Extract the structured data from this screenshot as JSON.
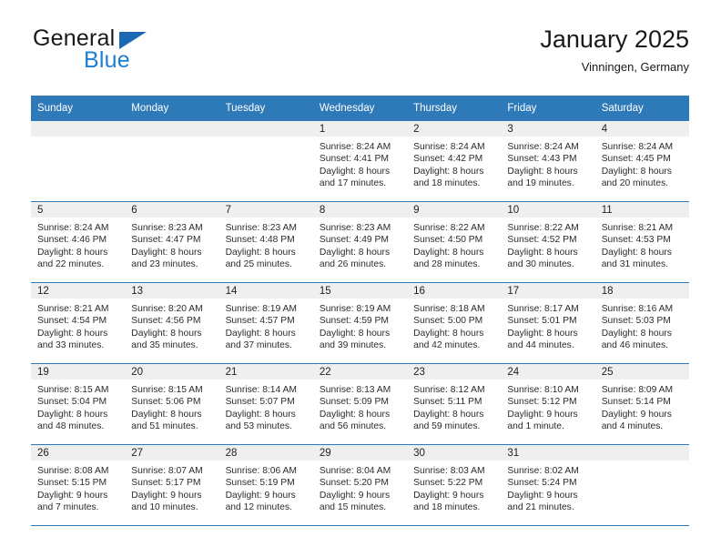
{
  "logo": {
    "word_one": "General",
    "word_two": "Blue",
    "triangle_color": "#1b68b3",
    "blue_color": "#1b7fd4"
  },
  "header": {
    "title": "January 2025",
    "location": "Vinningen, Germany"
  },
  "theme": {
    "header_bg": "#2e7ab8",
    "daynum_bg": "#efefef",
    "row_rule": "#2e7ab8"
  },
  "weekday_headers": [
    "Sunday",
    "Monday",
    "Tuesday",
    "Wednesday",
    "Thursday",
    "Friday",
    "Saturday"
  ],
  "weeks": [
    [
      {
        "day": "",
        "sunrise": "",
        "sunset": "",
        "daylight_line1": "",
        "daylight_line2": ""
      },
      {
        "day": "",
        "sunrise": "",
        "sunset": "",
        "daylight_line1": "",
        "daylight_line2": ""
      },
      {
        "day": "",
        "sunrise": "",
        "sunset": "",
        "daylight_line1": "",
        "daylight_line2": ""
      },
      {
        "day": "1",
        "sunrise": "Sunrise: 8:24 AM",
        "sunset": "Sunset: 4:41 PM",
        "daylight_line1": "Daylight: 8 hours",
        "daylight_line2": "and 17 minutes."
      },
      {
        "day": "2",
        "sunrise": "Sunrise: 8:24 AM",
        "sunset": "Sunset: 4:42 PM",
        "daylight_line1": "Daylight: 8 hours",
        "daylight_line2": "and 18 minutes."
      },
      {
        "day": "3",
        "sunrise": "Sunrise: 8:24 AM",
        "sunset": "Sunset: 4:43 PM",
        "daylight_line1": "Daylight: 8 hours",
        "daylight_line2": "and 19 minutes."
      },
      {
        "day": "4",
        "sunrise": "Sunrise: 8:24 AM",
        "sunset": "Sunset: 4:45 PM",
        "daylight_line1": "Daylight: 8 hours",
        "daylight_line2": "and 20 minutes."
      }
    ],
    [
      {
        "day": "5",
        "sunrise": "Sunrise: 8:24 AM",
        "sunset": "Sunset: 4:46 PM",
        "daylight_line1": "Daylight: 8 hours",
        "daylight_line2": "and 22 minutes."
      },
      {
        "day": "6",
        "sunrise": "Sunrise: 8:23 AM",
        "sunset": "Sunset: 4:47 PM",
        "daylight_line1": "Daylight: 8 hours",
        "daylight_line2": "and 23 minutes."
      },
      {
        "day": "7",
        "sunrise": "Sunrise: 8:23 AM",
        "sunset": "Sunset: 4:48 PM",
        "daylight_line1": "Daylight: 8 hours",
        "daylight_line2": "and 25 minutes."
      },
      {
        "day": "8",
        "sunrise": "Sunrise: 8:23 AM",
        "sunset": "Sunset: 4:49 PM",
        "daylight_line1": "Daylight: 8 hours",
        "daylight_line2": "and 26 minutes."
      },
      {
        "day": "9",
        "sunrise": "Sunrise: 8:22 AM",
        "sunset": "Sunset: 4:50 PM",
        "daylight_line1": "Daylight: 8 hours",
        "daylight_line2": "and 28 minutes."
      },
      {
        "day": "10",
        "sunrise": "Sunrise: 8:22 AM",
        "sunset": "Sunset: 4:52 PM",
        "daylight_line1": "Daylight: 8 hours",
        "daylight_line2": "and 30 minutes."
      },
      {
        "day": "11",
        "sunrise": "Sunrise: 8:21 AM",
        "sunset": "Sunset: 4:53 PM",
        "daylight_line1": "Daylight: 8 hours",
        "daylight_line2": "and 31 minutes."
      }
    ],
    [
      {
        "day": "12",
        "sunrise": "Sunrise: 8:21 AM",
        "sunset": "Sunset: 4:54 PM",
        "daylight_line1": "Daylight: 8 hours",
        "daylight_line2": "and 33 minutes."
      },
      {
        "day": "13",
        "sunrise": "Sunrise: 8:20 AM",
        "sunset": "Sunset: 4:56 PM",
        "daylight_line1": "Daylight: 8 hours",
        "daylight_line2": "and 35 minutes."
      },
      {
        "day": "14",
        "sunrise": "Sunrise: 8:19 AM",
        "sunset": "Sunset: 4:57 PM",
        "daylight_line1": "Daylight: 8 hours",
        "daylight_line2": "and 37 minutes."
      },
      {
        "day": "15",
        "sunrise": "Sunrise: 8:19 AM",
        "sunset": "Sunset: 4:59 PM",
        "daylight_line1": "Daylight: 8 hours",
        "daylight_line2": "and 39 minutes."
      },
      {
        "day": "16",
        "sunrise": "Sunrise: 8:18 AM",
        "sunset": "Sunset: 5:00 PM",
        "daylight_line1": "Daylight: 8 hours",
        "daylight_line2": "and 42 minutes."
      },
      {
        "day": "17",
        "sunrise": "Sunrise: 8:17 AM",
        "sunset": "Sunset: 5:01 PM",
        "daylight_line1": "Daylight: 8 hours",
        "daylight_line2": "and 44 minutes."
      },
      {
        "day": "18",
        "sunrise": "Sunrise: 8:16 AM",
        "sunset": "Sunset: 5:03 PM",
        "daylight_line1": "Daylight: 8 hours",
        "daylight_line2": "and 46 minutes."
      }
    ],
    [
      {
        "day": "19",
        "sunrise": "Sunrise: 8:15 AM",
        "sunset": "Sunset: 5:04 PM",
        "daylight_line1": "Daylight: 8 hours",
        "daylight_line2": "and 48 minutes."
      },
      {
        "day": "20",
        "sunrise": "Sunrise: 8:15 AM",
        "sunset": "Sunset: 5:06 PM",
        "daylight_line1": "Daylight: 8 hours",
        "daylight_line2": "and 51 minutes."
      },
      {
        "day": "21",
        "sunrise": "Sunrise: 8:14 AM",
        "sunset": "Sunset: 5:07 PM",
        "daylight_line1": "Daylight: 8 hours",
        "daylight_line2": "and 53 minutes."
      },
      {
        "day": "22",
        "sunrise": "Sunrise: 8:13 AM",
        "sunset": "Sunset: 5:09 PM",
        "daylight_line1": "Daylight: 8 hours",
        "daylight_line2": "and 56 minutes."
      },
      {
        "day": "23",
        "sunrise": "Sunrise: 8:12 AM",
        "sunset": "Sunset: 5:11 PM",
        "daylight_line1": "Daylight: 8 hours",
        "daylight_line2": "and 59 minutes."
      },
      {
        "day": "24",
        "sunrise": "Sunrise: 8:10 AM",
        "sunset": "Sunset: 5:12 PM",
        "daylight_line1": "Daylight: 9 hours",
        "daylight_line2": "and 1 minute."
      },
      {
        "day": "25",
        "sunrise": "Sunrise: 8:09 AM",
        "sunset": "Sunset: 5:14 PM",
        "daylight_line1": "Daylight: 9 hours",
        "daylight_line2": "and 4 minutes."
      }
    ],
    [
      {
        "day": "26",
        "sunrise": "Sunrise: 8:08 AM",
        "sunset": "Sunset: 5:15 PM",
        "daylight_line1": "Daylight: 9 hours",
        "daylight_line2": "and 7 minutes."
      },
      {
        "day": "27",
        "sunrise": "Sunrise: 8:07 AM",
        "sunset": "Sunset: 5:17 PM",
        "daylight_line1": "Daylight: 9 hours",
        "daylight_line2": "and 10 minutes."
      },
      {
        "day": "28",
        "sunrise": "Sunrise: 8:06 AM",
        "sunset": "Sunset: 5:19 PM",
        "daylight_line1": "Daylight: 9 hours",
        "daylight_line2": "and 12 minutes."
      },
      {
        "day": "29",
        "sunrise": "Sunrise: 8:04 AM",
        "sunset": "Sunset: 5:20 PM",
        "daylight_line1": "Daylight: 9 hours",
        "daylight_line2": "and 15 minutes."
      },
      {
        "day": "30",
        "sunrise": "Sunrise: 8:03 AM",
        "sunset": "Sunset: 5:22 PM",
        "daylight_line1": "Daylight: 9 hours",
        "daylight_line2": "and 18 minutes."
      },
      {
        "day": "31",
        "sunrise": "Sunrise: 8:02 AM",
        "sunset": "Sunset: 5:24 PM",
        "daylight_line1": "Daylight: 9 hours",
        "daylight_line2": "and 21 minutes."
      },
      {
        "day": "",
        "sunrise": "",
        "sunset": "",
        "daylight_line1": "",
        "daylight_line2": ""
      }
    ]
  ]
}
